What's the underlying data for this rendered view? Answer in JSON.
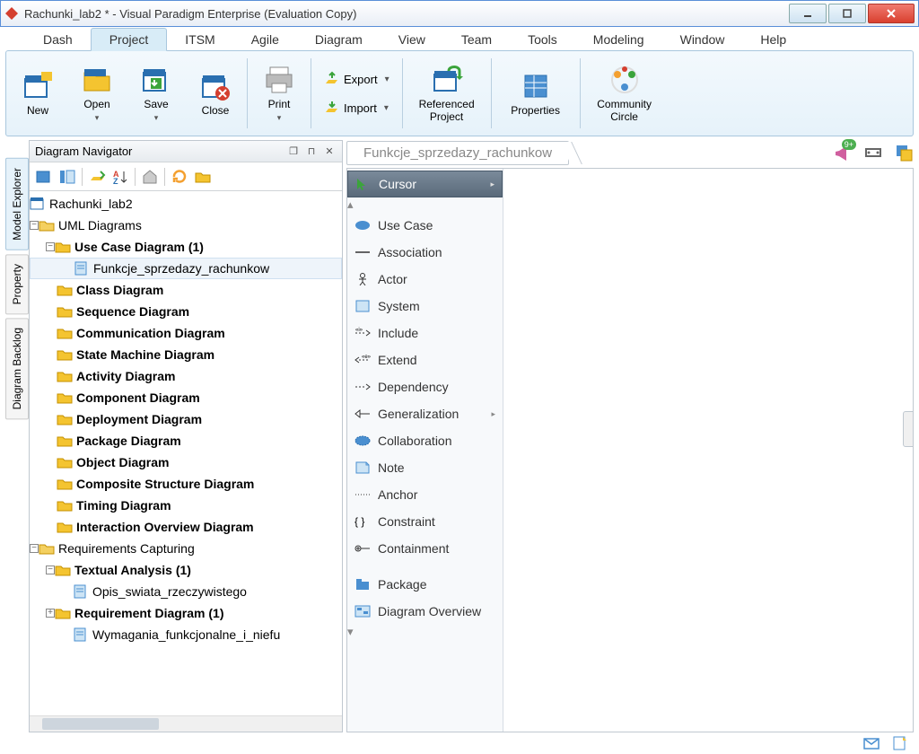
{
  "window": {
    "title": "Rachunki_lab2 * - Visual Paradigm Enterprise (Evaluation Copy)"
  },
  "menu": {
    "tabs": [
      "Dash",
      "Project",
      "ITSM",
      "Agile",
      "Diagram",
      "View",
      "Team",
      "Tools",
      "Modeling",
      "Window",
      "Help"
    ],
    "active": 1
  },
  "ribbon": {
    "new": "New",
    "open": "Open",
    "save": "Save",
    "close": "Close",
    "print": "Print",
    "export": "Export",
    "import": "Import",
    "referenced": "Referenced\nProject",
    "properties": "Properties",
    "community": "Community\nCircle"
  },
  "navigator": {
    "title": "Diagram Navigator",
    "root": "Rachunki_lab2",
    "uml": "UML Diagrams",
    "items": [
      {
        "label": "Use Case Diagram (1)",
        "bold": true,
        "children": [
          {
            "label": "Funkcje_sprzedazy_rachunkow",
            "bold": false,
            "sel": true
          }
        ]
      },
      {
        "label": "Class Diagram",
        "bold": true
      },
      {
        "label": "Sequence Diagram",
        "bold": true
      },
      {
        "label": "Communication Diagram",
        "bold": true
      },
      {
        "label": "State Machine Diagram",
        "bold": true
      },
      {
        "label": "Activity Diagram",
        "bold": true
      },
      {
        "label": "Component Diagram",
        "bold": true
      },
      {
        "label": "Deployment Diagram",
        "bold": true
      },
      {
        "label": "Package Diagram",
        "bold": true
      },
      {
        "label": "Object Diagram",
        "bold": true
      },
      {
        "label": "Composite Structure Diagram",
        "bold": true
      },
      {
        "label": "Timing Diagram",
        "bold": true
      },
      {
        "label": "Interaction Overview Diagram",
        "bold": true
      }
    ],
    "req": "Requirements Capturing",
    "req_items": [
      {
        "label": "Textual Analysis (1)",
        "bold": true,
        "children": [
          {
            "label": "Opis_swiata_rzeczywistego"
          }
        ]
      },
      {
        "label": "Requirement Diagram (1)",
        "bold": true,
        "children": [
          {
            "label": "Wymagania_funkcjonalne_i_niefu"
          }
        ]
      }
    ]
  },
  "sidetabs": {
    "model_explorer": "Model Explorer",
    "property": "Property",
    "diagram_backlog": "Diagram Backlog"
  },
  "doc_tab": "Funkcje_sprzedazy_rachunkow",
  "notif_badge": "9+",
  "palette": [
    {
      "label": "Cursor",
      "sel": true,
      "icon": "cursor"
    },
    {
      "label": "Use Case",
      "icon": "usecase"
    },
    {
      "label": "Association",
      "icon": "assoc"
    },
    {
      "label": "Actor",
      "icon": "actor"
    },
    {
      "label": "System",
      "icon": "system"
    },
    {
      "label": "Include",
      "icon": "include"
    },
    {
      "label": "Extend",
      "icon": "extend"
    },
    {
      "label": "Dependency",
      "icon": "dep"
    },
    {
      "label": "Generalization",
      "icon": "gen"
    },
    {
      "label": "Collaboration",
      "icon": "collab"
    },
    {
      "label": "Note",
      "icon": "note"
    },
    {
      "label": "Anchor",
      "icon": "anchor"
    },
    {
      "label": "Constraint",
      "icon": "constraint"
    },
    {
      "label": "Containment",
      "icon": "contain"
    },
    {
      "label": "Package",
      "icon": "package",
      "group": true
    },
    {
      "label": "Diagram Overview",
      "icon": "overview"
    }
  ]
}
